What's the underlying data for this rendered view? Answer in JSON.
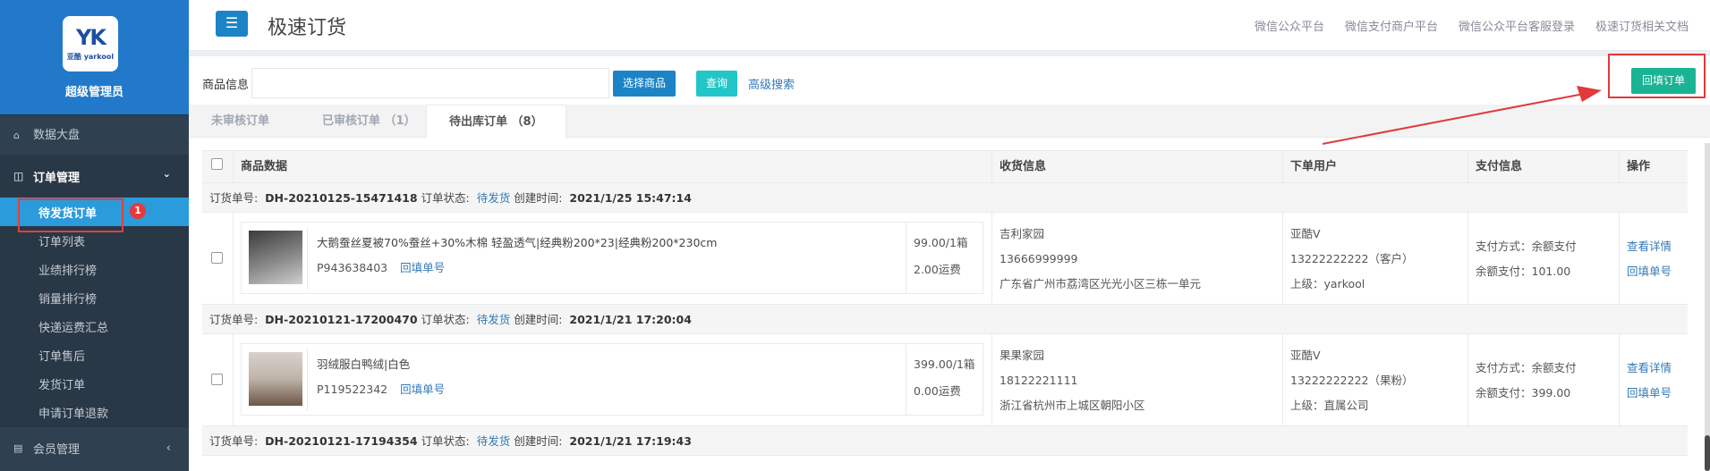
{
  "sidebar": {
    "logo_mark": "YK",
    "logo_brand": "亚酷 yarkool",
    "admin_name": "超级管理员",
    "dashboard": "数据大盘",
    "order_group": "订单管理",
    "items": [
      "待发货订单",
      "订单列表",
      "业绩排行榜",
      "销量排行榜",
      "快递运费汇总",
      "订单售后",
      "发货订单",
      "申请订单退款"
    ],
    "badge": "1",
    "member_group": "会员管理"
  },
  "header": {
    "title": "极速订货",
    "links": [
      "微信公众平台",
      "微信支付商户平台",
      "微信公众平台客服登录",
      "极速订货相关文档"
    ]
  },
  "search": {
    "label": "商品信息",
    "placeholder": "",
    "select_btn": "选择商品",
    "query_btn": "查询",
    "advanced": "高级搜索",
    "refill_btn": "回填订单"
  },
  "tabs": [
    {
      "label": "未审核订单"
    },
    {
      "label": "已审核订单 （1）"
    },
    {
      "label": "待出库订单 （8）"
    }
  ],
  "table": {
    "headers": [
      "商品数据",
      "收货信息",
      "下单用户",
      "支付信息",
      "操作"
    ],
    "orders": [
      {
        "no_label": "订货单号:",
        "no": "DH-20210125-15471418",
        "status_label": "订单状态:",
        "status": "待发货",
        "created_label": "创建时间:",
        "created": "2021/1/25 15:47:14",
        "product_name": "大鹅蚕丝夏被70%蚕丝+30%木棉 轻盈透气|经典粉200*23|经典粉200*230cm",
        "product_code": "P943638403",
        "refill_no": "回填单号",
        "price": "99.00/1箱",
        "freight": "2.00运费",
        "receiver": "吉利家园",
        "phone": "13666999999",
        "address": "广东省广州市荔湾区光光小区三栋一单元",
        "user": "亚酷V",
        "user_phone": "13222222222（客户）",
        "superior": "上级：yarkool",
        "pay_method": "支付方式：余额支付",
        "pay_amount": "余额支付：101.00",
        "op_detail": "查看详情",
        "op_refill": "回填单号"
      },
      {
        "no_label": "订货单号:",
        "no": "DH-20210121-17200470",
        "status_label": "订单状态:",
        "status": "待发货",
        "created_label": "创建时间:",
        "created": "2021/1/21 17:20:04",
        "product_name": "羽绒服白鸭绒|白色",
        "product_code": "P119522342",
        "refill_no": "回填单号",
        "price": "399.00/1箱",
        "freight": "0.00运费",
        "receiver": "果果家园",
        "phone": "18122221111",
        "address": "浙江省杭州市上城区朝阳小区",
        "user": "亚酷V",
        "user_phone": "13222222222（果粉）",
        "superior": "上级：直属公司",
        "pay_method": "支付方式：余额支付",
        "pay_amount": "余额支付：399.00",
        "op_detail": "查看详情",
        "op_refill": "回填单号"
      },
      {
        "no_label": "订货单号:",
        "no": "DH-20210121-17194354",
        "status_label": "订单状态:",
        "status": "待发货",
        "created_label": "创建时间:",
        "created": "2021/1/21 17:19:43"
      }
    ]
  },
  "colors": {
    "sidebar": "#2f4050",
    "active": "#2b9bdb",
    "primary": "#1c84c6",
    "cyan": "#23c6c8",
    "green": "#1ab394",
    "highlight": "#e03a3a"
  }
}
